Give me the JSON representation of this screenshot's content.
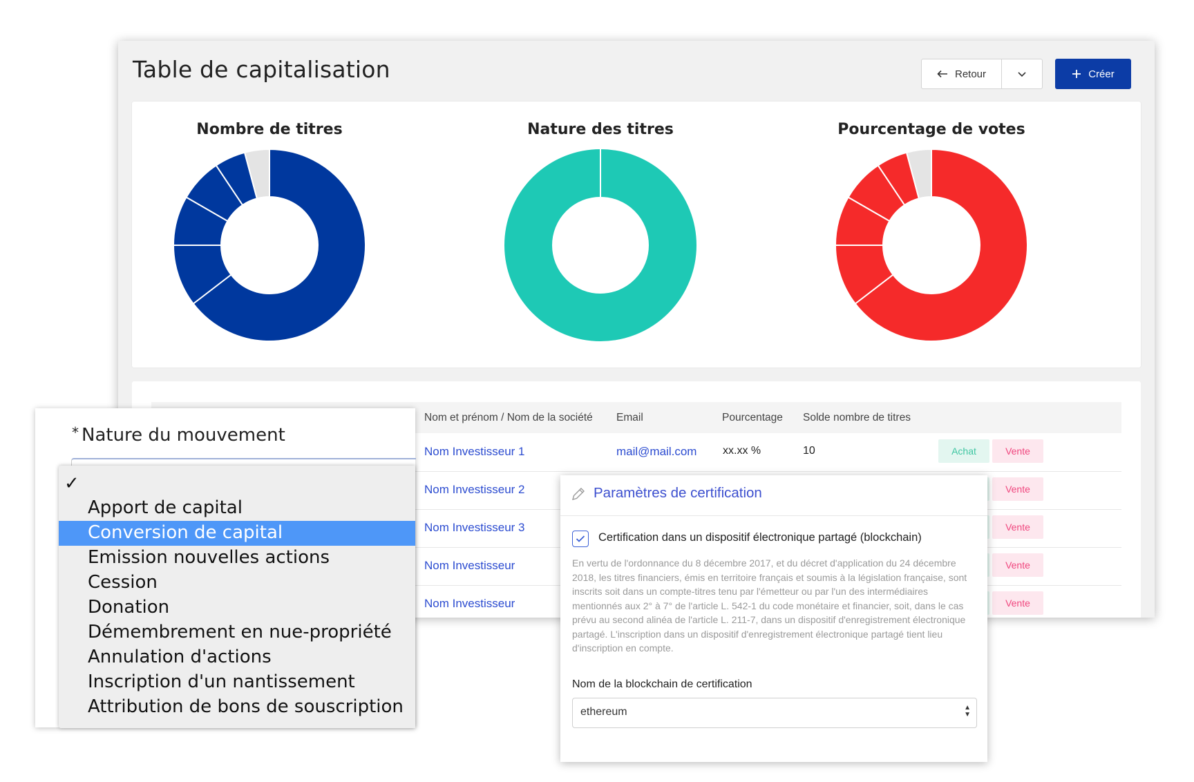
{
  "header": {
    "title": "Table de capitalisation",
    "back_label": "Retour",
    "create_label": "Créer"
  },
  "charts_titles": [
    "Nombre de titres",
    "Nature des titres",
    "Pourcentage de votes"
  ],
  "chart_data": [
    {
      "type": "pie",
      "title": "Nombre de titres",
      "values": [
        62,
        10,
        8,
        7,
        5,
        4
      ],
      "colors": [
        "#00389e",
        "#00389e",
        "#00389e",
        "#00389e",
        "#00389e",
        "#e4e4e4"
      ]
    },
    {
      "type": "pie",
      "title": "Nature des titres",
      "values": [
        100
      ],
      "colors": [
        "#1ec9b5"
      ]
    },
    {
      "type": "pie",
      "title": "Pourcentage de votes",
      "values": [
        62,
        10,
        8,
        7,
        5,
        4
      ],
      "colors": [
        "#f52a2a",
        "#f52a2a",
        "#f52a2a",
        "#f52a2a",
        "#f52a2a",
        "#e4e4e4"
      ]
    }
  ],
  "table": {
    "columns": [
      "Nom et prénom / Nom de la société",
      "Email",
      "Pourcentage",
      "Solde nombre de titres"
    ],
    "rows": [
      {
        "name": "Nom Investisseur 1",
        "email": "mail@mail.com",
        "percent": "xx.xx %",
        "solde": "10"
      },
      {
        "name": "Nom Investisseur 2"
      },
      {
        "name": "Nom Investisseur 3"
      },
      {
        "name": "Nom Investisseur"
      },
      {
        "name": "Nom Investisseur"
      }
    ],
    "buy_label": "Achat",
    "sell_label": "Vente"
  },
  "movement": {
    "required_mark": "*",
    "label": "Nature du mouvement",
    "options": [
      "Apport de capital",
      "Conversion de capital",
      "Emission nouvelles actions",
      "Cession",
      "Donation",
      "Démembrement en nue-propriété",
      "Annulation d'actions",
      "Inscription d'un nantissement",
      "Attribution de bons de souscription"
    ],
    "selected_option": "Conversion de capital"
  },
  "certification": {
    "title": "Paramètres de certification",
    "checkbox_label": "Certification dans un dispositif électronique partagé (blockchain)",
    "checked": true,
    "legal_text": "En vertu de l'ordonnance du 8 décembre 2017, et du décret d'application du 24 décembre 2018, les titres financiers, émis en territoire français et soumis à la législation française, sont inscrits soit dans un compte-titres tenu par l'émetteur ou par l'un des intermédiaires mentionnés aux 2° à 7° de l'article L. 542-1 du code monétaire et financier, soit, dans le cas prévu au second alinéa de l'article L. 211-7, dans un dispositif d'enregistrement électronique partagé. L'inscription dans un dispositif d'enregistrement électronique partagé tient lieu d'inscription en compte.",
    "select_label": "Nom de la blockchain de certification",
    "select_value": "ethereum"
  },
  "colors": {
    "primary": "#0c3ca6",
    "link": "#2b4bd0",
    "teal": "#1ec9b5",
    "red": "#f52a2a",
    "selection": "#4e97f8"
  }
}
